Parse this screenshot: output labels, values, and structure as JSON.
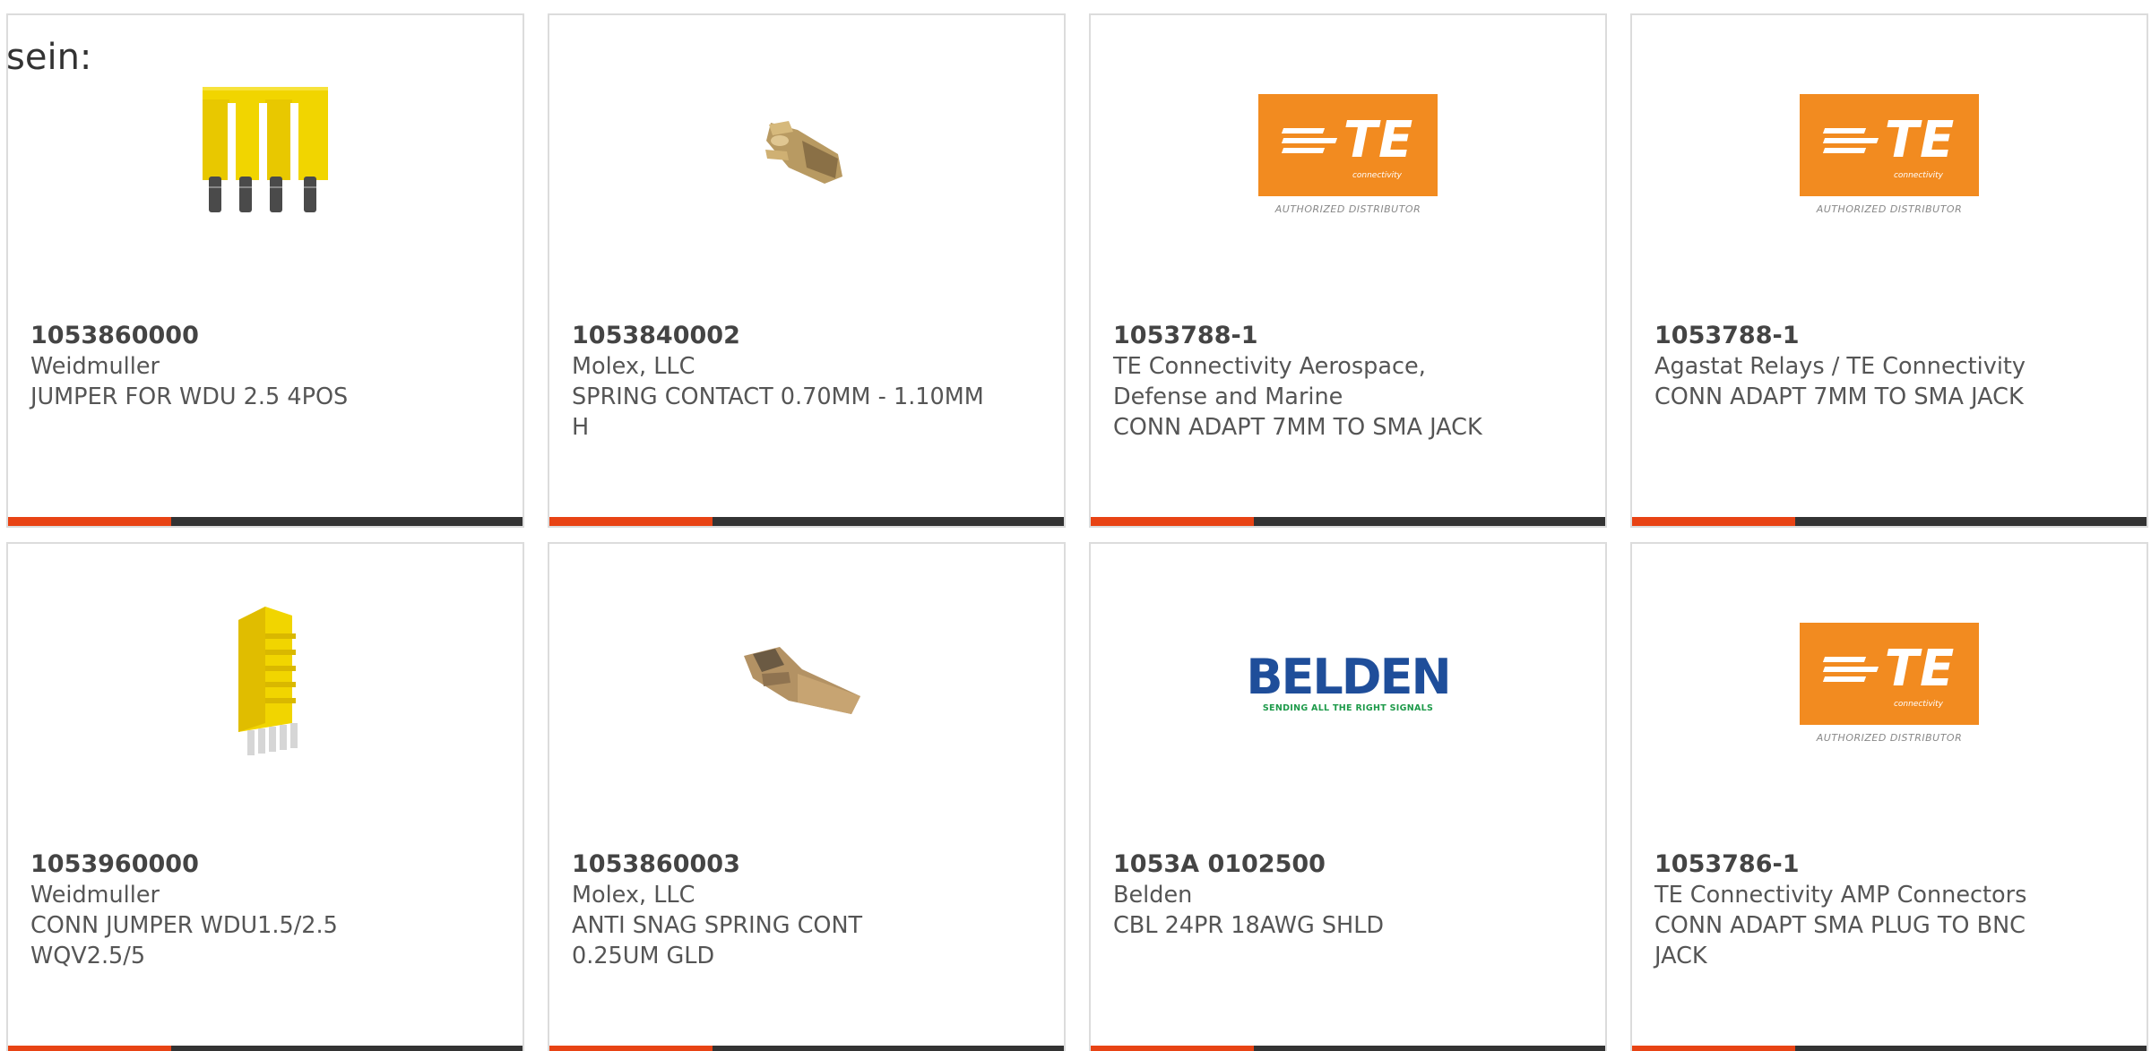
{
  "intro_text": "sein:",
  "logo_text": {
    "te_mark": "TE",
    "te_sub": "connectivity",
    "te_authorized": "AUTHORIZED DISTRIBUTOR",
    "belden_word": "BELDEN",
    "belden_tag": "SENDING ALL THE RIGHT SIGNALS"
  },
  "colors": {
    "accent": "#e84314",
    "bar": "#333333",
    "te_orange": "#f28b20",
    "belden_blue": "#1f4e9a",
    "belden_green": "#1e9a4a"
  },
  "products": [
    {
      "part_number": "1053860000",
      "manufacturer": "Weidmuller",
      "description": "JUMPER FOR WDU 2.5 4POS",
      "image": "yellow-jumper-4pos-image"
    },
    {
      "part_number": "1053840002",
      "manufacturer": "Molex, LLC",
      "description": "SPRING CONTACT 0.70MM - 1.10MM H",
      "image": "spring-contact-image"
    },
    {
      "part_number": "1053788-1",
      "manufacturer": "TE Connectivity Aerospace, Defense and Marine",
      "description": "CONN ADAPT 7MM TO SMA JACK",
      "image": "te-connectivity-logo"
    },
    {
      "part_number": "1053788-1",
      "manufacturer": "Agastat Relays / TE Connectivity",
      "description": "CONN ADAPT 7MM TO SMA JACK",
      "image": "te-connectivity-logo"
    },
    {
      "part_number": "1053960000",
      "manufacturer": "Weidmuller",
      "description": "CONN JUMPER WDU1.5/2.5 WQV2.5/5",
      "image": "yellow-jumper-5pos-image"
    },
    {
      "part_number": "1053860003",
      "manufacturer": "Molex, LLC",
      "description": "ANTI SNAG SPRING CONT 0.25UM GLD",
      "image": "spring-contact-image"
    },
    {
      "part_number": "1053A 0102500",
      "manufacturer": "Belden",
      "description": "CBL 24PR 18AWG SHLD",
      "image": "belden-logo"
    },
    {
      "part_number": "1053786-1",
      "manufacturer": "TE Connectivity AMP Connectors",
      "description": "CONN ADAPT SMA PLUG TO BNC JACK",
      "image": "te-connectivity-logo"
    }
  ]
}
